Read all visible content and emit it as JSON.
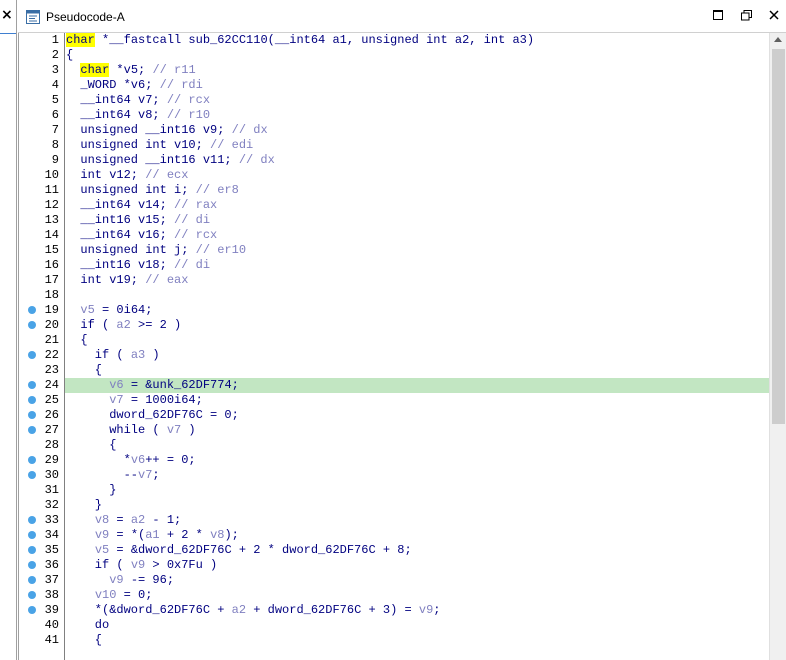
{
  "window": {
    "title": "Pseudocode-A",
    "left_panel_close": "×",
    "buttons": {
      "minimize": "□",
      "restore": "❐",
      "close": "×"
    }
  },
  "editor": {
    "current_line": 24,
    "breakpoint_lines": [
      19,
      20,
      22,
      24,
      25,
      26,
      27,
      29,
      30,
      33,
      34,
      35,
      36,
      37,
      38,
      39
    ],
    "lines": [
      {
        "n": "1",
        "segs": [
          {
            "t": "char",
            "c": "kw-hl"
          },
          {
            "t": " *__fastcall sub_62CC110(__int64 a1, unsigned int a2, int a3)"
          }
        ]
      },
      {
        "n": "2",
        "segs": [
          {
            "t": "{"
          }
        ]
      },
      {
        "n": "3",
        "segs": [
          {
            "t": "  "
          },
          {
            "t": "char",
            "c": "kw-hl"
          },
          {
            "t": " *v5; "
          },
          {
            "t": "// r11",
            "c": "cm"
          }
        ]
      },
      {
        "n": "4",
        "segs": [
          {
            "t": "  _WORD *v6; "
          },
          {
            "t": "// rdi",
            "c": "cm"
          }
        ]
      },
      {
        "n": "5",
        "segs": [
          {
            "t": "  __int64 v7; "
          },
          {
            "t": "// rcx",
            "c": "cm"
          }
        ]
      },
      {
        "n": "6",
        "segs": [
          {
            "t": "  __int64 v8; "
          },
          {
            "t": "// r10",
            "c": "cm"
          }
        ]
      },
      {
        "n": "7",
        "segs": [
          {
            "t": "  unsigned __int16 v9; "
          },
          {
            "t": "// dx",
            "c": "cm"
          }
        ]
      },
      {
        "n": "8",
        "segs": [
          {
            "t": "  unsigned int v10; "
          },
          {
            "t": "// edi",
            "c": "cm"
          }
        ]
      },
      {
        "n": "9",
        "segs": [
          {
            "t": "  unsigned __int16 v11; "
          },
          {
            "t": "// dx",
            "c": "cm"
          }
        ]
      },
      {
        "n": "10",
        "segs": [
          {
            "t": "  int v12; "
          },
          {
            "t": "// ecx",
            "c": "cm"
          }
        ]
      },
      {
        "n": "11",
        "segs": [
          {
            "t": "  unsigned int i; "
          },
          {
            "t": "// er8",
            "c": "cm"
          }
        ]
      },
      {
        "n": "12",
        "segs": [
          {
            "t": "  __int64 v14; "
          },
          {
            "t": "// rax",
            "c": "cm"
          }
        ]
      },
      {
        "n": "13",
        "segs": [
          {
            "t": "  __int16 v15; "
          },
          {
            "t": "// di",
            "c": "cm"
          }
        ]
      },
      {
        "n": "14",
        "segs": [
          {
            "t": "  __int64 v16; "
          },
          {
            "t": "// rcx",
            "c": "cm"
          }
        ]
      },
      {
        "n": "15",
        "segs": [
          {
            "t": "  unsigned int j; "
          },
          {
            "t": "// er10",
            "c": "cm"
          }
        ]
      },
      {
        "n": "16",
        "segs": [
          {
            "t": "  __int16 v18; "
          },
          {
            "t": "// di",
            "c": "cm"
          }
        ]
      },
      {
        "n": "17",
        "segs": [
          {
            "t": "  int v19; "
          },
          {
            "t": "// eax",
            "c": "cm"
          }
        ]
      },
      {
        "n": "18",
        "segs": [
          {
            "t": ""
          }
        ]
      },
      {
        "n": "19",
        "segs": [
          {
            "t": "  "
          },
          {
            "t": "v5",
            "c": "var"
          },
          {
            "t": " = 0i64;"
          }
        ]
      },
      {
        "n": "20",
        "segs": [
          {
            "t": "  if ( "
          },
          {
            "t": "a2",
            "c": "var"
          },
          {
            "t": " >= 2 )"
          }
        ]
      },
      {
        "n": "21",
        "segs": [
          {
            "t": "  {"
          }
        ]
      },
      {
        "n": "22",
        "segs": [
          {
            "t": "    if ( "
          },
          {
            "t": "a3",
            "c": "var"
          },
          {
            "t": " )"
          }
        ]
      },
      {
        "n": "23",
        "segs": [
          {
            "t": "    {"
          }
        ]
      },
      {
        "n": "24",
        "segs": [
          {
            "t": "      "
          },
          {
            "t": "v6",
            "c": "var"
          },
          {
            "t": " = &unk_62DF774;"
          }
        ]
      },
      {
        "n": "25",
        "segs": [
          {
            "t": "      "
          },
          {
            "t": "v7",
            "c": "var"
          },
          {
            "t": " = 1000i64;"
          }
        ]
      },
      {
        "n": "26",
        "segs": [
          {
            "t": "      dword_62DF76C = 0;"
          }
        ]
      },
      {
        "n": "27",
        "segs": [
          {
            "t": "      while ( "
          },
          {
            "t": "v7",
            "c": "var"
          },
          {
            "t": " )"
          }
        ]
      },
      {
        "n": "28",
        "segs": [
          {
            "t": "      {"
          }
        ]
      },
      {
        "n": "29",
        "segs": [
          {
            "t": "        *"
          },
          {
            "t": "v6",
            "c": "var"
          },
          {
            "t": "++ = 0;"
          }
        ]
      },
      {
        "n": "30",
        "segs": [
          {
            "t": "        --"
          },
          {
            "t": "v7",
            "c": "var"
          },
          {
            "t": ";"
          }
        ]
      },
      {
        "n": "31",
        "segs": [
          {
            "t": "      }"
          }
        ]
      },
      {
        "n": "32",
        "segs": [
          {
            "t": "    }"
          }
        ]
      },
      {
        "n": "33",
        "segs": [
          {
            "t": "    "
          },
          {
            "t": "v8",
            "c": "var"
          },
          {
            "t": " = "
          },
          {
            "t": "a2",
            "c": "var"
          },
          {
            "t": " - 1;"
          }
        ]
      },
      {
        "n": "34",
        "segs": [
          {
            "t": "    "
          },
          {
            "t": "v9",
            "c": "var"
          },
          {
            "t": " = *("
          },
          {
            "t": "a1",
            "c": "var"
          },
          {
            "t": " + 2 * "
          },
          {
            "t": "v8",
            "c": "var"
          },
          {
            "t": ");"
          }
        ]
      },
      {
        "n": "35",
        "segs": [
          {
            "t": "    "
          },
          {
            "t": "v5",
            "c": "var"
          },
          {
            "t": " = &dword_62DF76C + 2 * dword_62DF76C + 8;"
          }
        ]
      },
      {
        "n": "36",
        "segs": [
          {
            "t": "    if ( "
          },
          {
            "t": "v9",
            "c": "var"
          },
          {
            "t": " > 0x7Fu )"
          }
        ]
      },
      {
        "n": "37",
        "segs": [
          {
            "t": "      "
          },
          {
            "t": "v9",
            "c": "var"
          },
          {
            "t": " -= 96;"
          }
        ]
      },
      {
        "n": "38",
        "segs": [
          {
            "t": "    "
          },
          {
            "t": "v10",
            "c": "var"
          },
          {
            "t": " = 0;"
          }
        ]
      },
      {
        "n": "39",
        "segs": [
          {
            "t": "    *(&dword_62DF76C + "
          },
          {
            "t": "a2",
            "c": "var"
          },
          {
            "t": " + dword_62DF76C + 3) = "
          },
          {
            "t": "v9",
            "c": "var"
          },
          {
            "t": ";"
          }
        ]
      },
      {
        "n": "40",
        "segs": [
          {
            "t": "    do"
          }
        ]
      },
      {
        "n": "41",
        "segs": [
          {
            "t": "    {"
          }
        ]
      }
    ]
  }
}
